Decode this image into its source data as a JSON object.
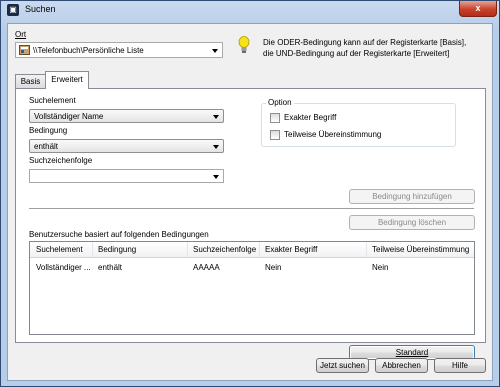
{
  "window": {
    "title": "Suchen",
    "close": "x"
  },
  "location": {
    "label": "Ort",
    "value": "\\\\Telefonbuch\\Persönliche Liste"
  },
  "hint": {
    "text_line1": "Die ODER-Bedingung kann auf der Registerkarte [Basis],",
    "text_line2": "die UND-Bedingung auf der Registerkarte [Erweitert]"
  },
  "tabs": {
    "basis": "Basis",
    "erweitert": "Erweitert"
  },
  "form": {
    "suchelement_label": "Suchelement",
    "suchelement_value": "Vollständiger Name",
    "bedingung_label": "Bedingung",
    "bedingung_value": "enthält",
    "suchzeichenfolge_label": "Suchzeichenfolge",
    "suchzeichenfolge_value": ""
  },
  "options": {
    "title": "Option",
    "exakter_begriff": "Exakter Begriff",
    "teilweise": "Teilweise Übereinstimmung"
  },
  "buttons": {
    "add_condition": "Bedingung hinzufügen",
    "delete_condition": "Bedingung löschen",
    "standard": "Standard",
    "search_now": "Jetzt suchen",
    "cancel": "Abbrechen",
    "help": "Hilfe"
  },
  "conditions": {
    "caption": "Benutzersuche basiert auf folgenden Bedingungen",
    "headers": [
      "Suchelement",
      "Bedingung",
      "Suchzeichenfolge",
      "Exakter Begriff",
      "Teilweise Übereinstimmung"
    ],
    "rows": [
      [
        "Vollständiger ...",
        "enthält",
        "AAAAA",
        "Nein",
        "Nein"
      ]
    ]
  },
  "icons": {
    "location": "phonebook-icon",
    "hint": "lightbulb-icon"
  },
  "colors": {
    "accent": "#3c7fb1",
    "hint_bulb": "#f5e31a"
  }
}
